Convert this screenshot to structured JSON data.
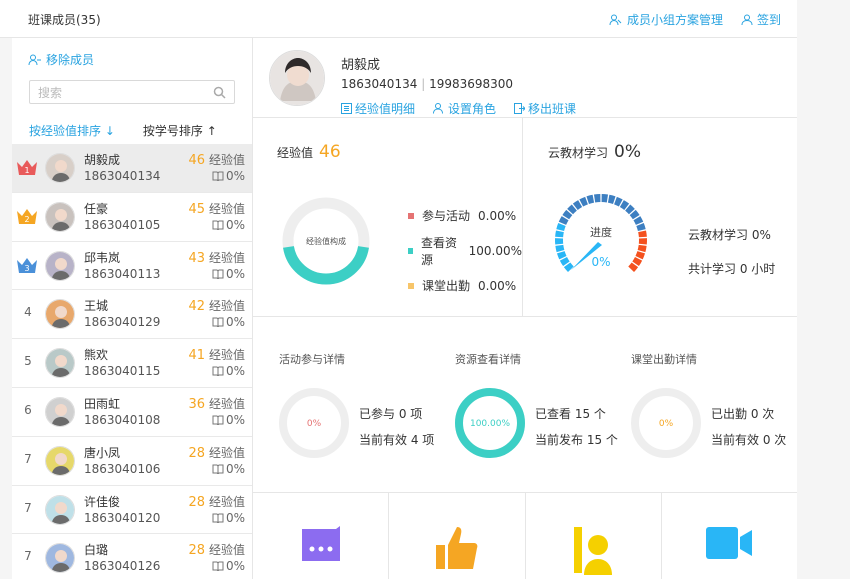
{
  "header": {
    "title": "班课成员(35)",
    "group_plan": "成员小组方案管理",
    "signin": "签到"
  },
  "left": {
    "remove": "移除成员",
    "search_placeholder": "搜索",
    "sort_exp": "按经验值排序",
    "sort_exp_arrow": "↓",
    "sort_id": "按学号排序",
    "sort_id_arrow": "↑",
    "exp_unit": "经验值",
    "members": [
      {
        "rank": "1",
        "name": "胡毅成",
        "id": "1863040134",
        "score": "46",
        "pct": "0%",
        "crown_color": "#e85a5a"
      },
      {
        "rank": "2",
        "name": "任豪",
        "id": "1863040105",
        "score": "45",
        "pct": "0%",
        "crown_color": "#f5a623"
      },
      {
        "rank": "3",
        "name": "邱韦岚",
        "id": "1863040113",
        "score": "43",
        "pct": "0%",
        "crown_color": "#4a90d9"
      },
      {
        "rank": "4",
        "name": "王城",
        "id": "1863040129",
        "score": "42",
        "pct": "0%"
      },
      {
        "rank": "5",
        "name": "熊欢",
        "id": "1863040115",
        "score": "41",
        "pct": "0%"
      },
      {
        "rank": "6",
        "name": "田雨虹",
        "id": "1863040108",
        "score": "36",
        "pct": "0%"
      },
      {
        "rank": "7",
        "name": "唐小凤",
        "id": "1863040106",
        "score": "28",
        "pct": "0%"
      },
      {
        "rank": "7",
        "name": "许佳俊",
        "id": "1863040120",
        "score": "28",
        "pct": "0%"
      },
      {
        "rank": "7",
        "name": "白璐",
        "id": "1863040126",
        "score": "28",
        "pct": "0%"
      }
    ]
  },
  "profile": {
    "name": "胡毅成",
    "phone_a": "1863040134",
    "phone_sep": "|",
    "phone_b": "19983698300",
    "link_exp": "经验值明细",
    "link_role": "设置角色",
    "link_remove": "移出班课"
  },
  "exp_panel": {
    "title": "经验值",
    "value": "46",
    "donut_label": "经验值构成",
    "legend": [
      {
        "label": "参与活动",
        "value": "0.00%",
        "color": "#e57373",
        "fraction": 0
      },
      {
        "label": "查看资源",
        "value": "100.00%",
        "color": "#3ccfc5",
        "fraction": 1
      },
      {
        "label": "课堂出勤",
        "value": "0.00%",
        "color": "#f7c56a",
        "fraction": 0
      }
    ]
  },
  "cloud_panel": {
    "title": "云教材学习",
    "value": "0%",
    "gauge_label": "进度",
    "gauge_value": "0%",
    "info_line1": "云教材学习 0%",
    "info_line2": "共计学习 0 小时"
  },
  "details": [
    {
      "title": "活动参与详情",
      "ring_value": "0%",
      "ring_color": "#e57373",
      "fraction": 0,
      "line1": "已参与 0 项",
      "line2": "当前有效 4 项"
    },
    {
      "title": "资源查看详情",
      "ring_value": "100.00%",
      "ring_color": "#3ccfc5",
      "fraction": 1,
      "line1": "已查看 15 个",
      "line2": "当前发布 15 个"
    },
    {
      "title": "课堂出勤详情",
      "ring_value": "0%",
      "ring_color": "#f5a623",
      "fraction": 0,
      "line1": "已出勤 0 次",
      "line2": "当前有效 0 次"
    }
  ],
  "tiles": [
    {
      "icon": "chat-bubble-icon",
      "color": "#8c6cf0"
    },
    {
      "icon": "thumbs-up-icon",
      "color": "#f5a623"
    },
    {
      "icon": "teacher-icon",
      "color": "#f5d000"
    },
    {
      "icon": "video-camera-icon",
      "color": "#29b6f6"
    }
  ]
}
